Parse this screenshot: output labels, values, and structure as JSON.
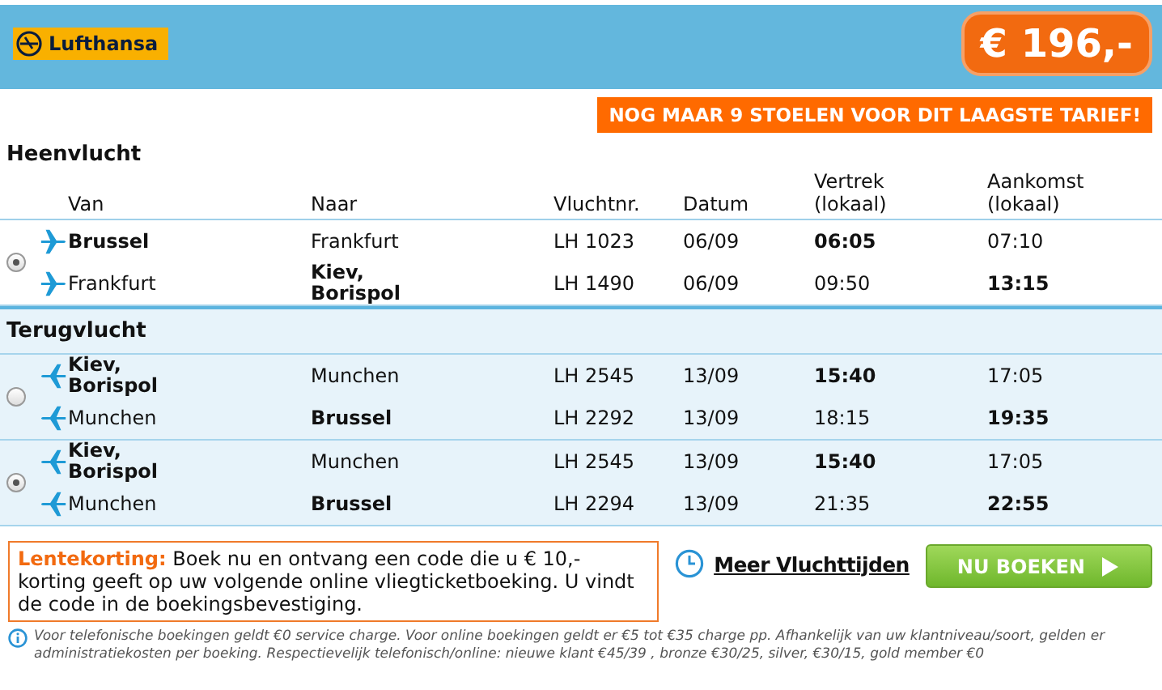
{
  "header": {
    "airline": "Lufthansa",
    "price": "€ 196,-"
  },
  "banner": "NOG MAAR 9 STOELEN VOOR DIT LAAGSTE TARIEF!",
  "columns": [
    "Van",
    "Naar",
    "Vluchtnr.",
    "Datum",
    "Vertrek\n(lokaal)",
    "Aankomst\n(lokaal)"
  ],
  "sections": [
    {
      "title": "Heenvlucht",
      "kind": "outbound",
      "options": [
        {
          "selected": true,
          "legs": [
            {
              "kind": "departure",
              "from": "Brussel",
              "to": "Frankfurt",
              "flight": "LH 1023",
              "date": "06/09",
              "departure": "06:05",
              "arrival": "07:10"
            },
            {
              "kind": "arrival",
              "from": "Frankfurt",
              "to": "Kiev, Borispol",
              "flight": "LH 1490",
              "date": "06/09",
              "departure": "09:50",
              "arrival": "13:15"
            }
          ]
        }
      ]
    },
    {
      "title": "Terugvlucht",
      "kind": "return",
      "options": [
        {
          "selected": false,
          "legs": [
            {
              "kind": "departure",
              "from": "Kiev, Borispol",
              "to": "Munchen",
              "flight": "LH 2545",
              "date": "13/09",
              "departure": "15:40",
              "arrival": "17:05"
            },
            {
              "kind": "arrival",
              "from": "Munchen",
              "to": "Brussel",
              "flight": "LH 2292",
              "date": "13/09",
              "departure": "18:15",
              "arrival": "19:35"
            }
          ]
        },
        {
          "selected": true,
          "legs": [
            {
              "kind": "departure",
              "from": "Kiev, Borispol",
              "to": "Munchen",
              "flight": "LH 2545",
              "date": "13/09",
              "departure": "15:40",
              "arrival": "17:05"
            },
            {
              "kind": "arrival",
              "from": "Munchen",
              "to": "Brussel",
              "flight": "LH 2294",
              "date": "13/09",
              "departure": "21:35",
              "arrival": "22:55"
            }
          ]
        }
      ]
    }
  ],
  "promo": "**Lentekorting:** Boek nu en ontvang een code die u € 10,- korting geeft op uw volgende online vliegticketboeking. U vindt de code in de boekingsbevestiging.",
  "more_link": "Meer Vluchttijden",
  "book_button": "NU BOEKEN",
  "footnote": "Voor telefonische boekingen geldt €0 service charge. Voor online boekingen geldt er €5 tot €35 charge pp. Afhankelijk van uw klantniveau/soort, gelden er administratiekosten per boeking. Respectievelijk telefonisch/online: nieuwe klant €45/39 , bronze €30/25, silver, €30/15, gold member €0"
}
